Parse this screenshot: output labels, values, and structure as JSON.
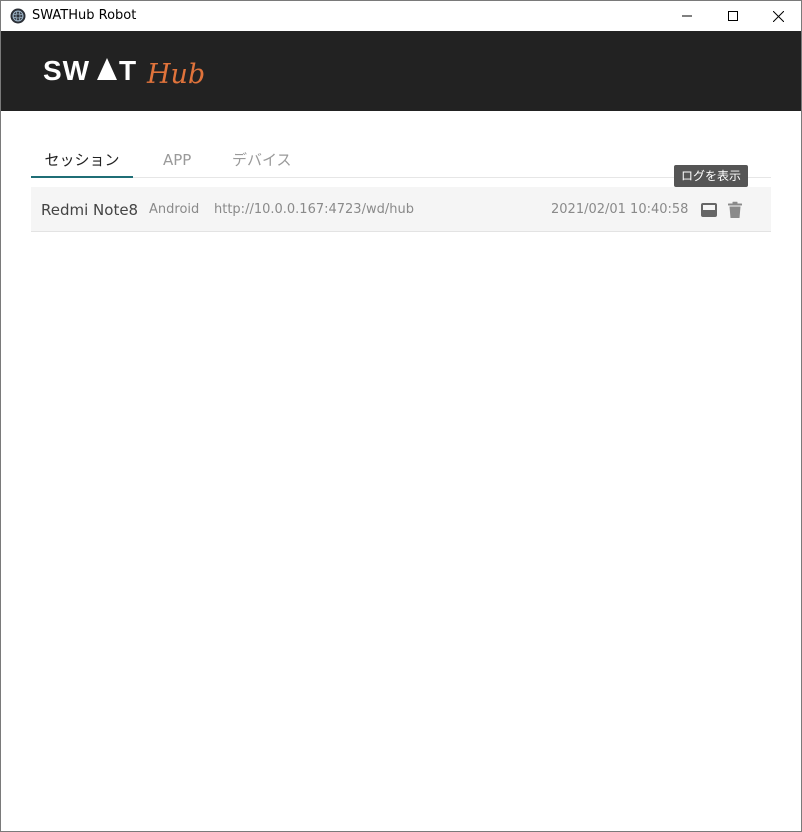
{
  "window": {
    "title": "SWATHub Robot",
    "controls": {
      "minimize": "minimize-icon",
      "maximize": "maximize-icon",
      "close": "close-icon"
    }
  },
  "header": {
    "logo_main": "SWAT",
    "logo_accent": "Hub",
    "background": "#222222",
    "accent_color": "#e0733b"
  },
  "tabs": [
    {
      "label": "セッション",
      "active": true
    },
    {
      "label": "APP",
      "active": false
    },
    {
      "label": "デバイス",
      "active": false
    }
  ],
  "sessions": [
    {
      "device": "Redmi Note8",
      "platform": "Android",
      "url": "http://10.0.0.167:4723/wd/hub",
      "timestamp": "2021/02/01 10:40:58",
      "actions": {
        "log_icon": "log-icon",
        "delete_icon": "trash-icon"
      }
    }
  ],
  "tooltip": {
    "text": "ログを表示"
  },
  "colors": {
    "active_tab_underline": "#1f6e76",
    "row_background": "#f5f5f5"
  }
}
